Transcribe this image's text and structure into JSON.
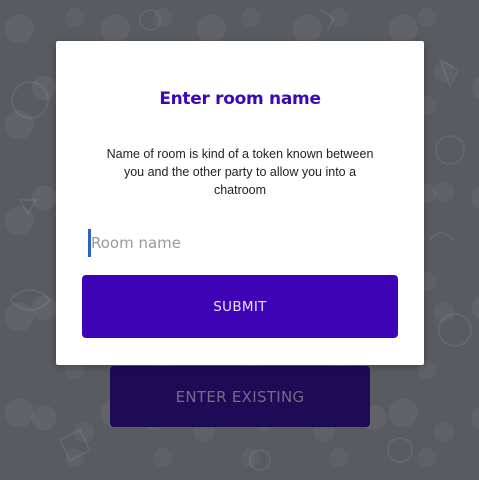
{
  "background": {
    "enter_existing_label": "ENTER EXISTING"
  },
  "modal": {
    "title": "Enter room name",
    "description": "Name of room is kind of a token known between you and the other party to allow you into a chatroom",
    "room_input": {
      "value": "",
      "placeholder": "Room name"
    },
    "submit_label": "SUBMIT"
  },
  "colors": {
    "accent": "#3e03b5",
    "title": "#3e06b5",
    "overlay_button": "#1f0a55"
  }
}
